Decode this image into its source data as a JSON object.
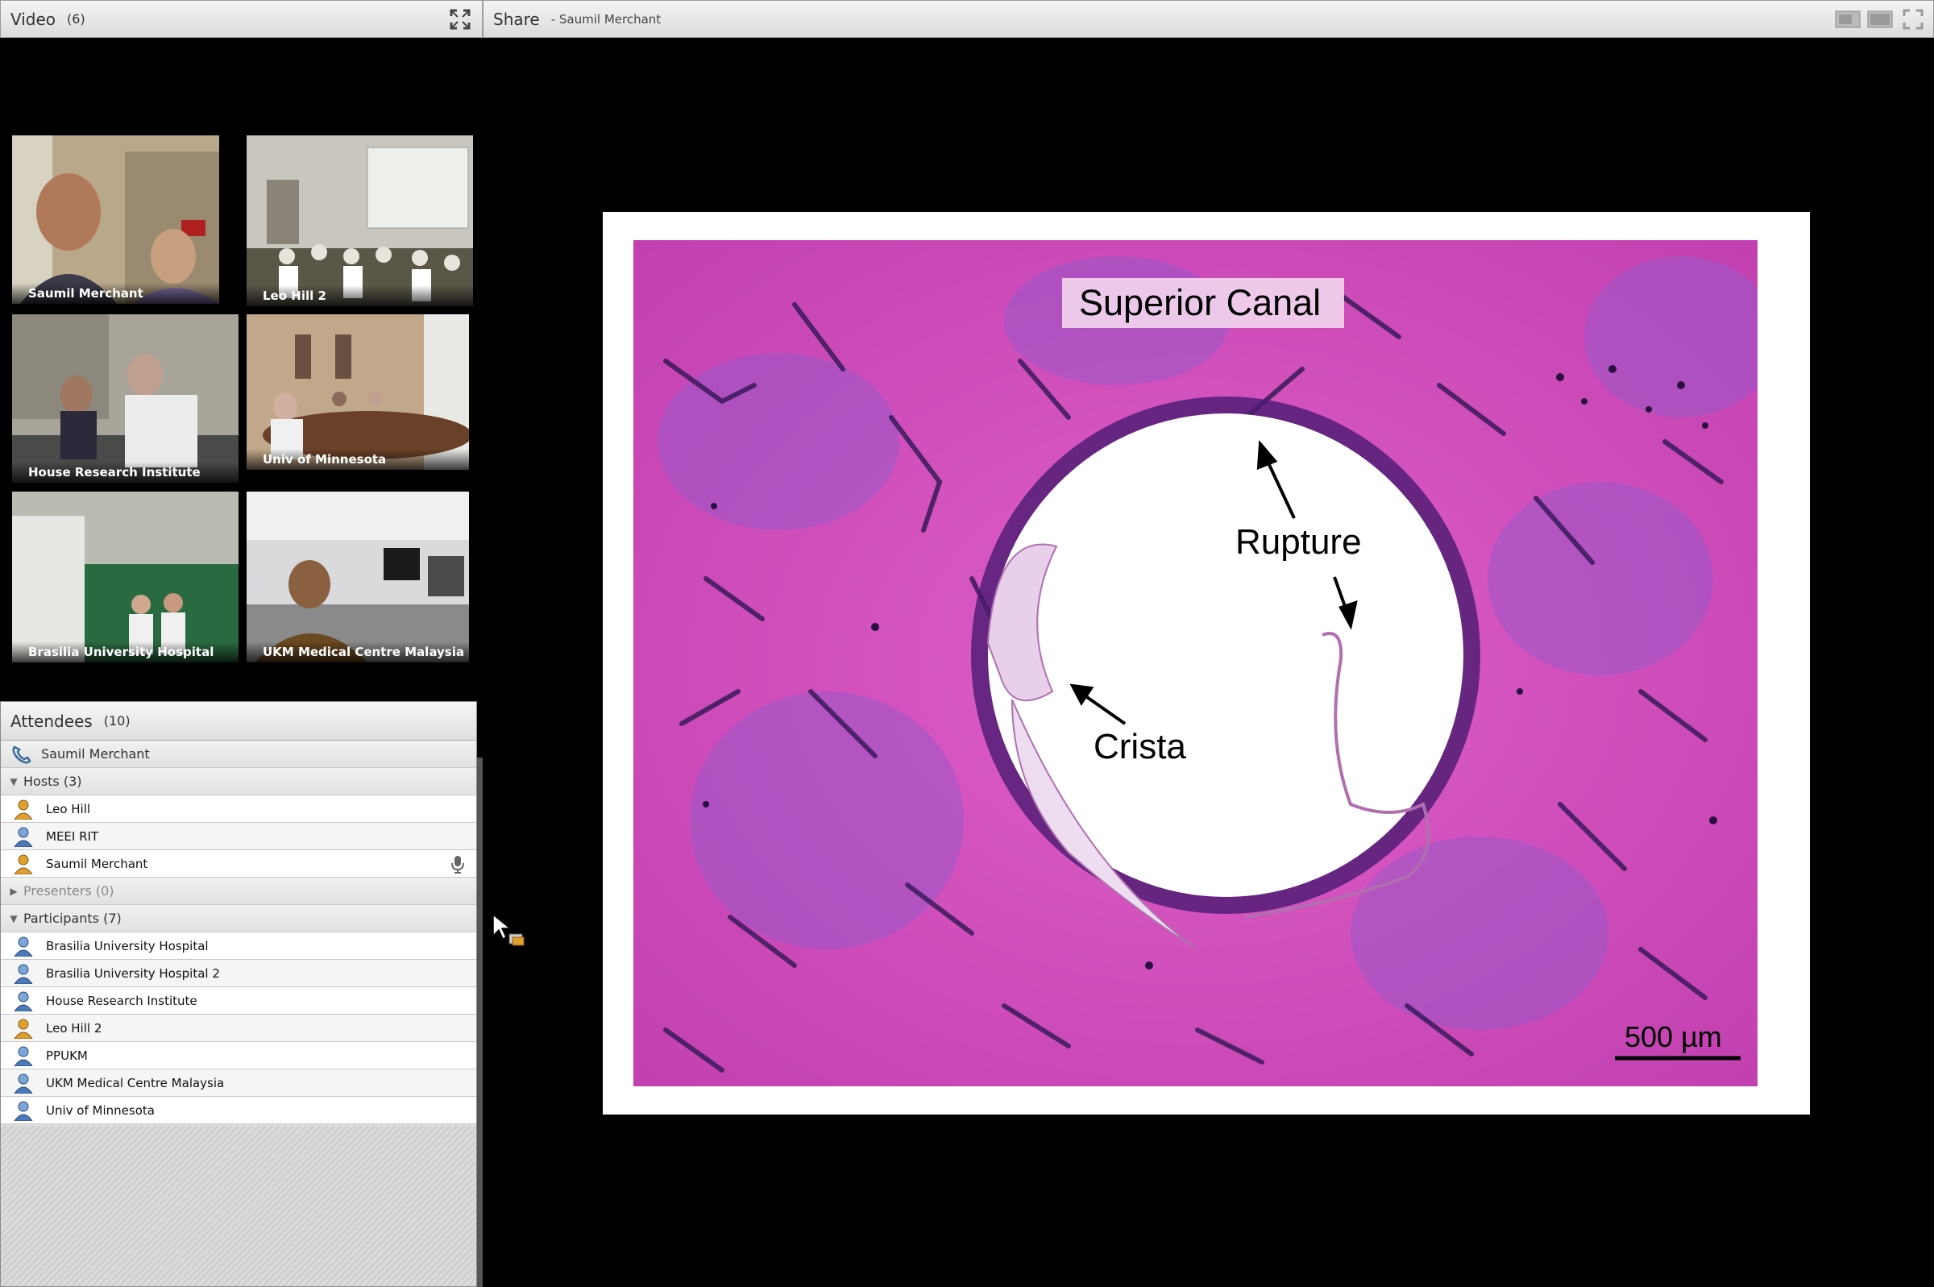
{
  "video": {
    "title": "Video",
    "count": "(6)",
    "tiles": [
      {
        "label": "Saumil Merchant"
      },
      {
        "label": "Leo Hill 2"
      },
      {
        "label": "House Research Institute"
      },
      {
        "label": "Univ of Minnesota"
      },
      {
        "label": "Brasilia University Hospital"
      },
      {
        "label": "UKM Medical Centre Malaysia"
      }
    ]
  },
  "share": {
    "title": "Share",
    "presenter": "- Saumil Merchant"
  },
  "slide": {
    "title": "Superior Canal",
    "label_rupture": "Rupture",
    "label_crista": "Crista",
    "scale_bar": "500 µm"
  },
  "attendees": {
    "title": "Attendees",
    "count": "(10)",
    "self": "Saumil Merchant",
    "hosts_label": "Hosts (3)",
    "hosts": [
      "Leo Hill",
      "MEEI RIT",
      "Saumil Merchant"
    ],
    "presenters_label": "Presenters (0)",
    "participants_label": "Participants (7)",
    "participants": [
      "Brasilia University Hospital",
      "Brasilia University Hospital 2",
      "House Research Institute",
      "Leo Hill 2",
      "PPUKM",
      "UKM Medical Centre Malaysia",
      "Univ of Minnesota"
    ]
  },
  "colors": {
    "host_icon": "#e0a030",
    "participant_icon": "#4a7ab8",
    "stain_pink": "#d84fc0",
    "stain_purple": "#5a2a8a"
  },
  "icons": {
    "video_fullscreen": "fullscreen-icon",
    "share_layout_1": "layout-icon",
    "share_layout_2": "layout-wide-icon",
    "share_fullscreen": "fullscreen-icon",
    "self_status": "phone-icon",
    "host": "host-person-icon",
    "participant": "participant-person-icon",
    "speaking": "microphone-icon",
    "cursor": "cursor-share-icon"
  }
}
